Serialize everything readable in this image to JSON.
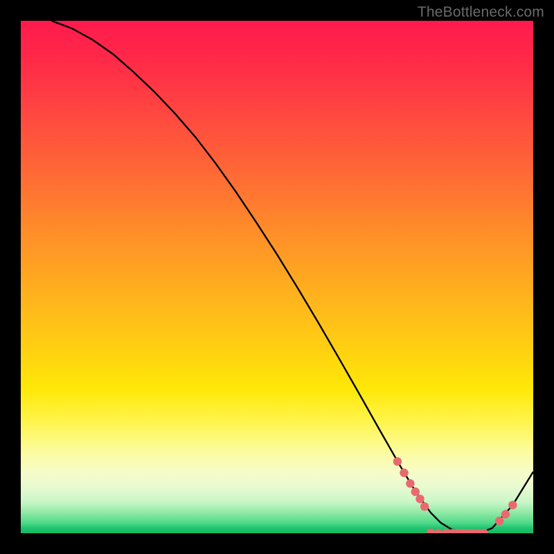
{
  "watermark": "TheBottleneck.com",
  "colors": {
    "curve_stroke": "#000000",
    "marker_fill": "#e86a6e",
    "marker_stroke": "#cc4d52"
  },
  "chart_data": {
    "type": "line",
    "title": "",
    "xlabel": "",
    "ylabel": "",
    "xlim": [
      0,
      100
    ],
    "ylim": [
      0,
      100
    ],
    "grid": false,
    "legend": false,
    "series": [
      {
        "name": "curve",
        "x": [
          6,
          10,
          14,
          18,
          22,
          26,
          30,
          34,
          38,
          42,
          46,
          50,
          54,
          58,
          62,
          66,
          70,
          74,
          77,
          80,
          82,
          84,
          86,
          88,
          90,
          92,
          96,
          100
        ],
        "y": [
          100,
          98.5,
          96.3,
          93.5,
          90.0,
          86.2,
          82.0,
          77.4,
          72.2,
          66.6,
          60.6,
          54.4,
          47.9,
          41.2,
          34.3,
          27.3,
          20.2,
          13.2,
          8.2,
          4.0,
          2.0,
          0.8,
          0.2,
          0.0,
          0.2,
          1.0,
          5.5,
          12.0
        ]
      }
    ],
    "markers": [
      {
        "x": 73.5,
        "y": 14.0
      },
      {
        "x": 74.8,
        "y": 11.8
      },
      {
        "x": 76.0,
        "y": 9.7
      },
      {
        "x": 77.0,
        "y": 8.1
      },
      {
        "x": 77.9,
        "y": 6.7
      },
      {
        "x": 78.8,
        "y": 5.2
      },
      {
        "x": 80.0,
        "y": 0.1
      },
      {
        "x": 81.5,
        "y": 0.0
      },
      {
        "x": 83.0,
        "y": 0.0
      },
      {
        "x": 84.3,
        "y": 0.0
      },
      {
        "x": 85.3,
        "y": 0.0
      },
      {
        "x": 86.3,
        "y": 0.0
      },
      {
        "x": 87.3,
        "y": 0.0
      },
      {
        "x": 88.3,
        "y": 0.0
      },
      {
        "x": 89.3,
        "y": 0.0
      },
      {
        "x": 90.4,
        "y": 0.0
      },
      {
        "x": 93.4,
        "y": 2.4
      },
      {
        "x": 94.6,
        "y": 3.7
      },
      {
        "x": 96.0,
        "y": 5.5
      }
    ]
  }
}
